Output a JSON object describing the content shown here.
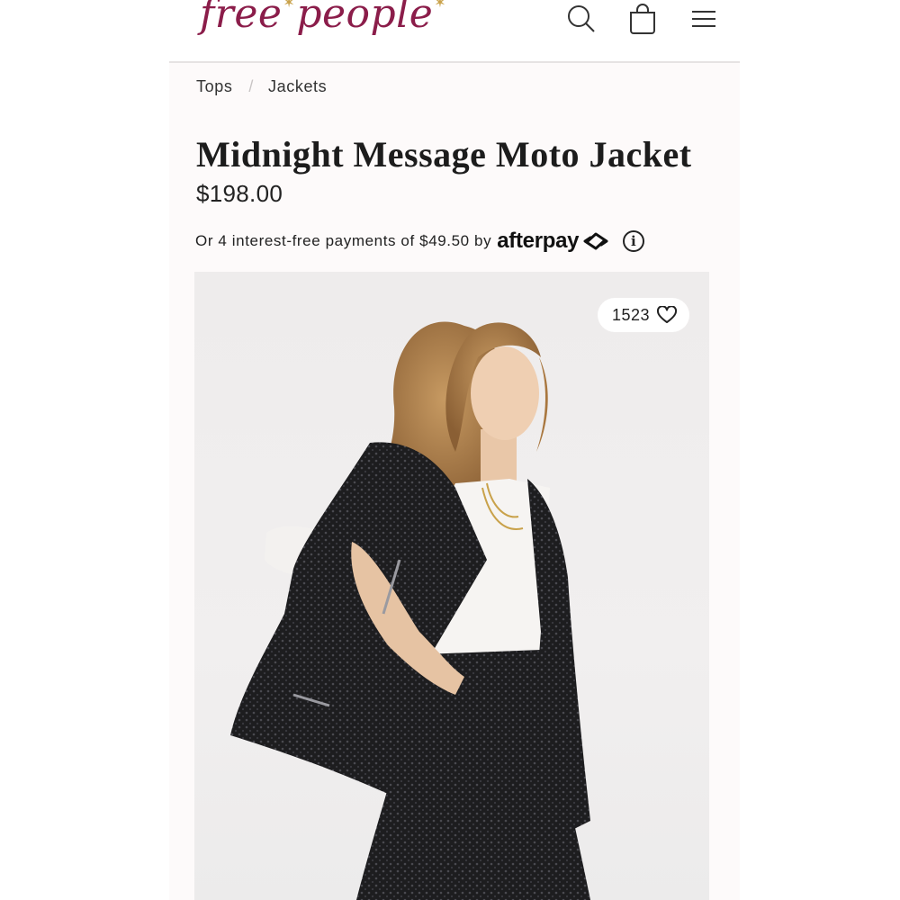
{
  "header": {
    "logo_left": "free",
    "logo_right": "people",
    "icons": [
      "search-icon",
      "bag-icon",
      "menu-icon"
    ]
  },
  "breadcrumb": {
    "items": [
      "Tops",
      "Jackets"
    ],
    "separator": "/"
  },
  "product": {
    "title": "Midnight Message Moto Jacket",
    "price": "$198.00",
    "afterpay_text": "Or 4 interest-free payments of $49.50 by",
    "afterpay_brand": "afterpay",
    "favorites_count": "1523"
  },
  "colors": {
    "brand": "#8b1d4a",
    "star": "#c9a24b",
    "background": "#fdfafa"
  }
}
